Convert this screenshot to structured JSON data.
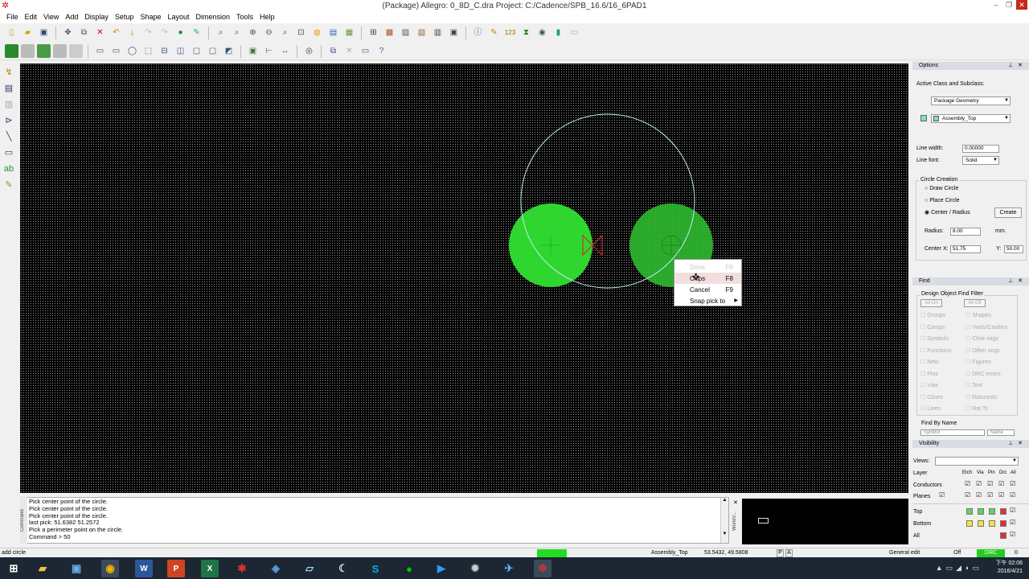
{
  "window": {
    "title": "(Package) Allegro: 0_8D_C.dra  Project: C:/Cadence/SPB_16.6/16_6PAD1",
    "brand": "cadence"
  },
  "menu": [
    "File",
    "Edit",
    "View",
    "Add",
    "Display",
    "Setup",
    "Shape",
    "Layout",
    "Dimension",
    "Tools",
    "Help"
  ],
  "context_menu": {
    "items": [
      {
        "label": "Done",
        "key": "F6",
        "state": "disabled"
      },
      {
        "label": "Oops",
        "key": "F8",
        "state": "hover"
      },
      {
        "label": "Cancel",
        "key": "F9",
        "state": "normal"
      },
      {
        "label": "Snap pick to",
        "key": "",
        "state": "submenu"
      }
    ]
  },
  "command": {
    "lines": [
      "Pick center point of the circle.",
      "Pick center point of the circle.",
      "Pick center point of the circle.",
      "last pick:  51.6382 51.2572",
      "Pick a perimeter point on the circle.",
      "Command > 50"
    ],
    "label": "Command",
    "world_label": "WorldV..."
  },
  "options": {
    "title": "Options",
    "active_class_label": "Active Class and Subclass:",
    "class": "Package Geometry",
    "subclass": "Assembly_Top",
    "subclass_color": "#7fe0b8",
    "line_width_label": "Line width:",
    "line_width": "0.00000",
    "line_font_label": "Line font:",
    "line_font": "Solid",
    "circle_creation_label": "Circle Creation",
    "radios": [
      {
        "label": "Draw Circle",
        "on": false
      },
      {
        "label": "Place Circle",
        "on": false
      },
      {
        "label": "Center / Radius",
        "on": true
      }
    ],
    "create_label": "Create",
    "radius_label": "Radius:",
    "radius": "8.00",
    "units": "mm.",
    "center_x_label": "Center X:",
    "center_x": "51.75",
    "center_y_label": "Y:",
    "center_y": "50.00"
  },
  "find": {
    "title": "Find",
    "filter_label": "Design Object Find Filter",
    "all_on": "All On",
    "all_off": "All Off",
    "left": [
      "Groups",
      "Comps",
      "Symbols",
      "Functions",
      "Nets",
      "Pins",
      "Vias",
      "Clines",
      "Lines"
    ],
    "right": [
      "Shapes",
      "Voids/Cavities",
      "Cline segs",
      "Other segs",
      "Figures",
      "DRC errors",
      "Text",
      "Ratsnests",
      "Rat Ts"
    ],
    "find_by_name_label": "Find By Name",
    "find_by_name_type": "Symbol",
    "find_by_name_mode": "Name"
  },
  "visibility": {
    "title": "Visibility",
    "views_label": "Views:",
    "views_value": "",
    "layer_label": "Layer",
    "col_headers": [
      "Etch",
      "Via",
      "Pin",
      "Drc",
      "All"
    ],
    "rows": [
      "Conductors",
      "Planes"
    ],
    "layers": [
      "Top",
      "Bottom",
      "All"
    ]
  },
  "status": {
    "command": "add circle",
    "subclass": "Assembly_Top",
    "coords": "53.5432, 49.5808",
    "p_btn": "P",
    "a_btn": "A",
    "mode": "General edit",
    "off": "Off",
    "drc": "DRC",
    "drc_count": "0"
  },
  "taskbar": {
    "time": "下午 02:06",
    "date": "2016/4/21"
  }
}
